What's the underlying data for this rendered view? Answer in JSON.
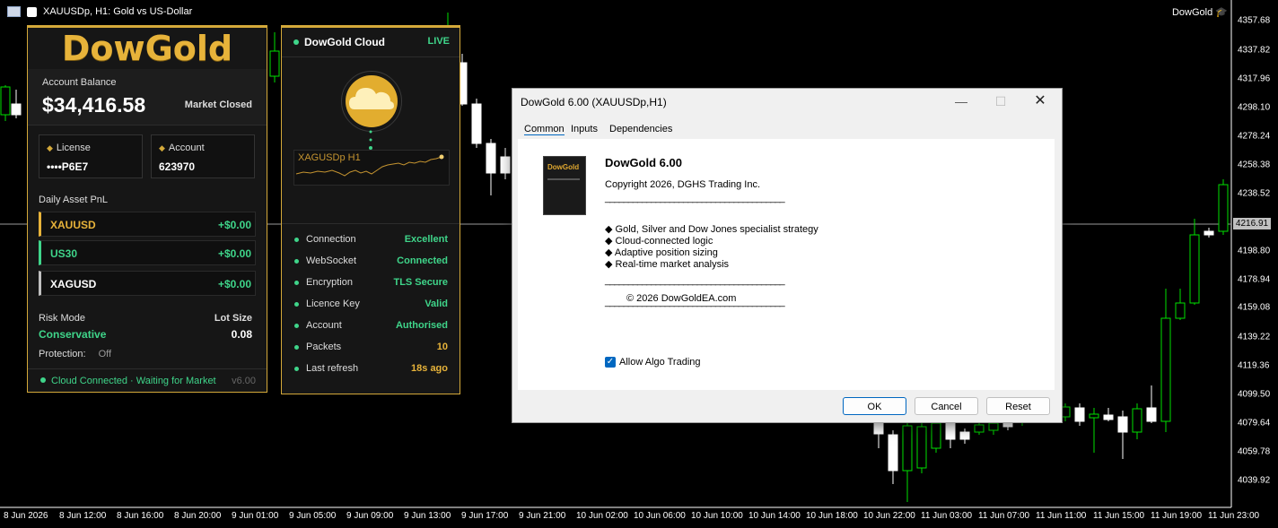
{
  "window": {
    "symbol_title": "XAUUSDp, H1:  Gold vs US-Dollar",
    "ea_badge": "DowGold",
    "ea_badge_icon": "graduation-cap-icon"
  },
  "price_axis": {
    "labels": [
      "4357.68",
      "4337.82",
      "4317.96",
      "4298.10",
      "4278.24",
      "4258.38",
      "4238.52",
      "4198.80",
      "4178.94",
      "4159.08",
      "4139.22",
      "4119.36",
      "4099.50",
      "4079.64",
      "4059.78",
      "4039.92"
    ],
    "current_price": "4216.91"
  },
  "time_axis": {
    "labels": [
      "8 Jun 2026",
      "8 Jun 12:00",
      "8 Jun 16:00",
      "8 Jun 20:00",
      "9 Jun 01:00",
      "9 Jun 05:00",
      "9 Jun 09:00",
      "9 Jun 13:00",
      "9 Jun 17:00",
      "9 Jun 21:00",
      "10 Jun 02:00",
      "10 Jun 06:00",
      "10 Jun 10:00",
      "10 Jun 14:00",
      "10 Jun 18:00",
      "10 Jun 22:00",
      "11 Jun 03:00",
      "11 Jun 07:00",
      "11 Jun 11:00",
      "11 Jun 15:00",
      "11 Jun 19:00",
      "11 Jun 23:00"
    ]
  },
  "left_panel": {
    "logo": "DowGold",
    "balance_label": "Account Balance",
    "balance_value": "$34,416.58",
    "market_status": "Market Closed",
    "license_label": "License",
    "license_value": "••••P6E7",
    "account_label": "Account",
    "account_value": "623970",
    "pnl_title": "Daily Asset PnL",
    "pnl_rows": [
      {
        "symbol": "XAUUSD",
        "amount": "+$0.00",
        "accent": "#e7b33a",
        "text_color": "#e7b33a"
      },
      {
        "symbol": "US30",
        "amount": "+$0.00",
        "accent": "#3fd58a",
        "text_color": "#3fd58a"
      },
      {
        "symbol": "XAGUSD",
        "amount": "+$0.00",
        "accent": "#bfbfbf",
        "text_color": "#ffffff"
      }
    ],
    "risk_label": "Risk Mode",
    "risk_value": "Conservative",
    "lot_label": "Lot Size",
    "lot_value": "0.08",
    "protection_label": "Protection:",
    "protection_value": "Off",
    "footer_status": "Cloud Connected · Waiting for Market",
    "version": "v6.00"
  },
  "cloud_panel": {
    "title": "DowGold Cloud",
    "live": "LIVE",
    "mini_chart_label": "XAGUSDp H1",
    "cloud_icon": "cloud-icon",
    "stats": [
      {
        "key": "Connection",
        "value": "Excellent",
        "color": "#3fd58a"
      },
      {
        "key": "WebSocket",
        "value": "Connected",
        "color": "#3fd58a"
      },
      {
        "key": "Encryption",
        "value": "TLS Secure",
        "color": "#3fd58a"
      },
      {
        "key": "Licence Key",
        "value": "Valid",
        "color": "#3fd58a"
      },
      {
        "key": "Account",
        "value": "Authorised",
        "color": "#3fd58a"
      },
      {
        "key": "Packets",
        "value": "10",
        "color": "#e7b33a"
      },
      {
        "key": "Last refresh",
        "value": "18s ago",
        "color": "#e7b33a"
      }
    ]
  },
  "dialog": {
    "title": "DowGold 6.00 (XAUUSDp,H1)",
    "tabs": [
      "Common",
      "Inputs",
      "Dependencies"
    ],
    "product_name": "DowGold 6.00",
    "copyright": "Copyright 2026, DGHS Trading Inc.",
    "rule": "_______________________________________",
    "features": [
      "◆ Gold, Silver and Dow Jones specialist strategy",
      "◆ Cloud-connected logic",
      "◆ Adaptive position sizing",
      "◆ Real-time market analysis"
    ],
    "site": "© 2026 DowGoldEA.com",
    "box_text": "DowGold",
    "allow_algo_label": "Allow Algo Trading",
    "allow_algo_checked": true,
    "buttons": {
      "ok": "OK",
      "cancel": "Cancel",
      "reset": "Reset"
    }
  }
}
